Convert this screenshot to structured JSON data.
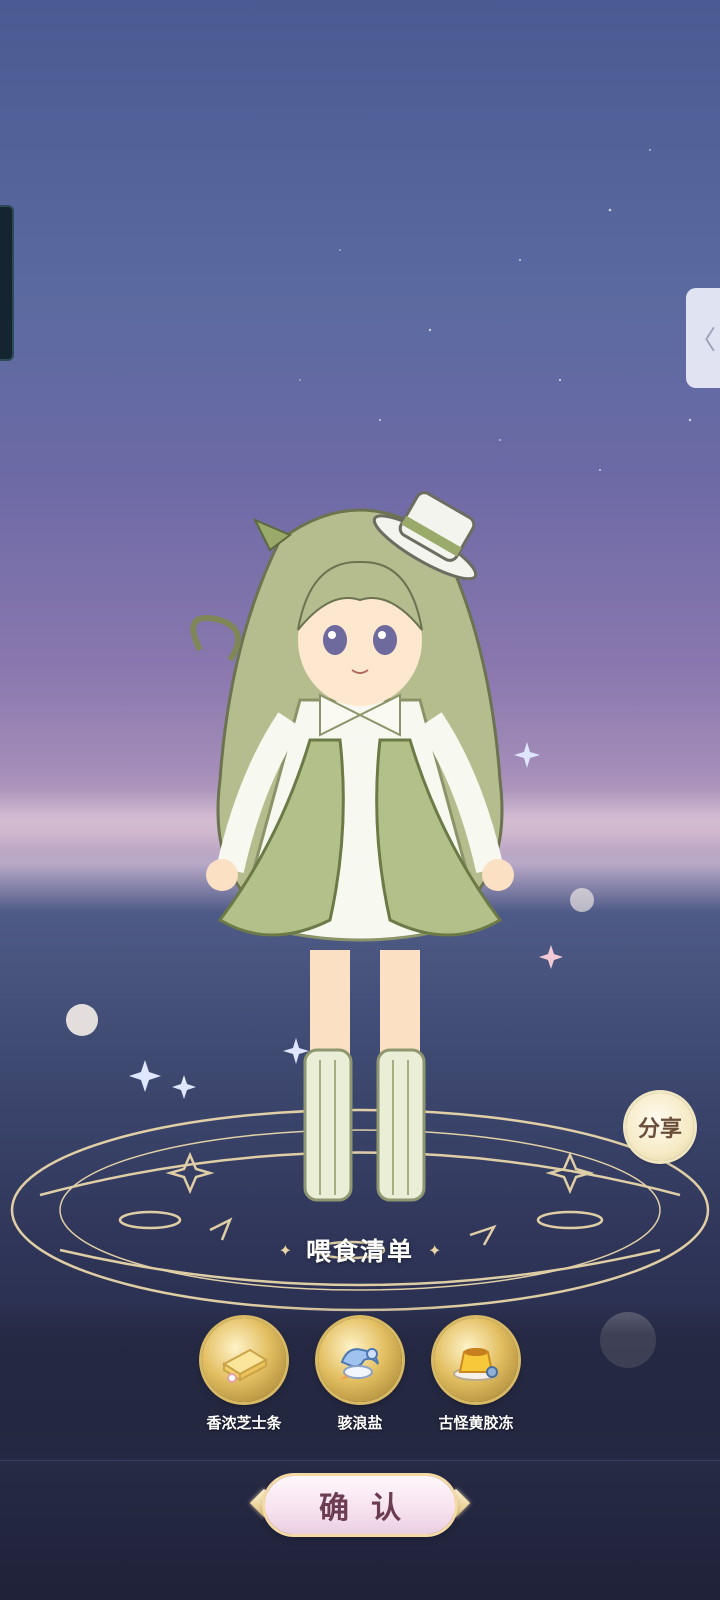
{
  "screen": {
    "share_label": "分享",
    "right_handle_glyph": "〈"
  },
  "feeding": {
    "title": "喂食清单",
    "items": [
      {
        "name": "香浓芝士条",
        "icon": "cheese-stick-icon"
      },
      {
        "name": "骇浪盐",
        "icon": "wave-salt-icon"
      },
      {
        "name": "古怪黄胶冻",
        "icon": "yellow-jelly-icon"
      }
    ]
  },
  "confirm_label": "确认",
  "colors": {
    "accent_gold": "#e3bf62",
    "button_text": "#6d3c52",
    "sky_top": "#4b5a92"
  }
}
